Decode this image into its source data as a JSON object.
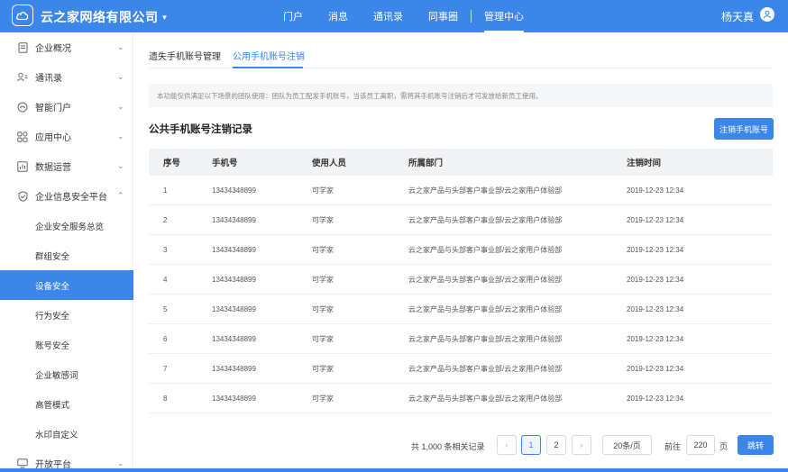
{
  "header": {
    "company": "云之家网络有限公司",
    "nav": [
      {
        "label": "门户"
      },
      {
        "label": "消息"
      },
      {
        "label": "通讯录"
      },
      {
        "label": "同事圈"
      },
      {
        "label": "管理中心"
      }
    ],
    "user_name": "杨天真"
  },
  "sidebar": {
    "items": [
      {
        "label": "企业概况",
        "icon": "document-icon"
      },
      {
        "label": "通讯录",
        "icon": "contacts-icon"
      },
      {
        "label": "智能门户",
        "icon": "portal-icon"
      },
      {
        "label": "应用中心",
        "icon": "apps-icon"
      },
      {
        "label": "数据运营",
        "icon": "chart-icon"
      },
      {
        "label": "企业信息安全平台",
        "icon": "shield-icon"
      }
    ],
    "sub_items": [
      {
        "label": "企业安全服务总览"
      },
      {
        "label": "群组安全"
      },
      {
        "label": "设备安全"
      },
      {
        "label": "行为安全"
      },
      {
        "label": "账号安全"
      },
      {
        "label": "企业敏感词"
      },
      {
        "label": "高管模式"
      },
      {
        "label": "水印自定义"
      }
    ],
    "last_item": {
      "label": "开放平台",
      "icon": "monitor-icon"
    }
  },
  "tabs": [
    {
      "label": "遗失手机账号管理"
    },
    {
      "label": "公用手机账号注销"
    }
  ],
  "notice": "本功能仅供满足以下场景的团队使用：团队为员工配发手机账号，当该员工离职，需将其手机账号注销后才可发放给新员工使用。",
  "section_title": "公共手机账号注销记录",
  "primary_button": "注销手机账号",
  "table": {
    "headers": [
      "序号",
      "手机号",
      "使用人员",
      "所属部门",
      "注销时间"
    ],
    "rows": [
      [
        "1",
        "13434348899",
        "可学家",
        "云之家产品与头部客户事业部/云之家用户体验部",
        "2019-12-23 12:34"
      ],
      [
        "2",
        "13434348899",
        "可学家",
        "云之家产品与头部客户事业部/云之家用户体验部",
        "2019-12-23 12:34"
      ],
      [
        "3",
        "13434348899",
        "可学家",
        "云之家产品与头部客户事业部/云之家用户体验部",
        "2019-12-23 12:34"
      ],
      [
        "4",
        "13434348899",
        "可学家",
        "云之家产品与头部客户事业部/云之家用户体验部",
        "2019-12-23 12:34"
      ],
      [
        "5",
        "13434348899",
        "可学家",
        "云之家产品与头部客户事业部/云之家用户体验部",
        "2019-12-23 12:34"
      ],
      [
        "6",
        "13434348899",
        "可学家",
        "云之家产品与头部客户事业部/云之家用户体验部",
        "2019-12-23 12:34"
      ],
      [
        "7",
        "13434348899",
        "可学家",
        "云之家产品与头部客户事业部/云之家用户体验部",
        "2019-12-23 12:34"
      ],
      [
        "8",
        "13434348899",
        "可学家",
        "云之家产品与头部客户事业部/云之家用户体验部",
        "2019-12-23 12:34"
      ]
    ]
  },
  "pagination": {
    "total": "共 1,000 条相关记录",
    "prev": "‹",
    "pages": [
      "1",
      "2"
    ],
    "next": "›",
    "page_size": "20条/页",
    "goto_label": "前往",
    "goto_value": "220",
    "page_unit": "页",
    "goto_button": "跳转"
  },
  "colors": {
    "primary": "#3b86e8"
  }
}
